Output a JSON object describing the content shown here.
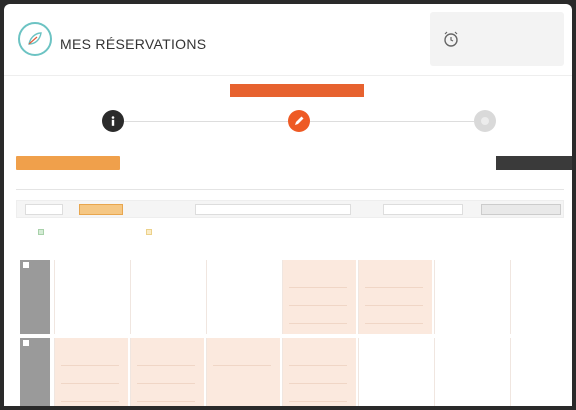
{
  "colors": {
    "accent": "#ee5a24",
    "banner": "#e7622f",
    "history_button": "#f0a04b",
    "price_text": "#e0624a",
    "cell_tint": "#fbe9de",
    "logo_ring": "#6cc3c3"
  },
  "header": {
    "brand_small": "",
    "title": "MES RÉSERVATIONS",
    "timer_label": "",
    "timer_value": ""
  },
  "steps": {
    "banner": "",
    "items": [
      {
        "icon": "info-icon",
        "state": "done"
      },
      {
        "icon": "pencil-icon",
        "state": "active"
      },
      {
        "icon": "circle-icon",
        "state": "pending"
      }
    ]
  },
  "actions": {
    "history": "",
    "next": ""
  },
  "info_line": "",
  "toolbar": {
    "view_a": "",
    "view_b": "",
    "date_range": "",
    "period_select": "",
    "apply": ""
  },
  "legend": {
    "modified": "",
    "partial": "",
    "right": ""
  },
  "calendar": {
    "days": [
      "",
      "",
      "",
      "",
      "",
      "",
      ""
    ],
    "weeks": [
      {
        "cells": [
          {
            "price": "",
            "slots": [],
            "tinted": false
          },
          {
            "price": "",
            "slots": [],
            "tinted": false
          },
          {
            "price": "",
            "slots": [],
            "tinted": false
          },
          {
            "price": "",
            "slots": [
              "",
              "",
              ""
            ],
            "tinted": true
          },
          {
            "price": "",
            "slots": [
              "",
              "",
              ""
            ],
            "tinted": true
          },
          {
            "price": "",
            "slots": [],
            "tinted": false
          },
          {
            "price": "",
            "slots": [],
            "tinted": false
          }
        ]
      },
      {
        "cells": [
          {
            "price": "",
            "slots": [
              "",
              "",
              ""
            ],
            "tinted": true
          },
          {
            "price": "",
            "slots": [
              "",
              "",
              ""
            ],
            "tinted": true
          },
          {
            "price": "",
            "slots": [
              ""
            ],
            "tinted": true
          },
          {
            "price": "",
            "slots": [
              "",
              "",
              ""
            ],
            "tinted": true
          },
          {
            "price": "",
            "slots": [],
            "tinted": false
          },
          {
            "price": "",
            "slots": [],
            "tinted": false
          },
          {
            "price": "",
            "slots": [],
            "tinted": false
          }
        ]
      }
    ]
  }
}
